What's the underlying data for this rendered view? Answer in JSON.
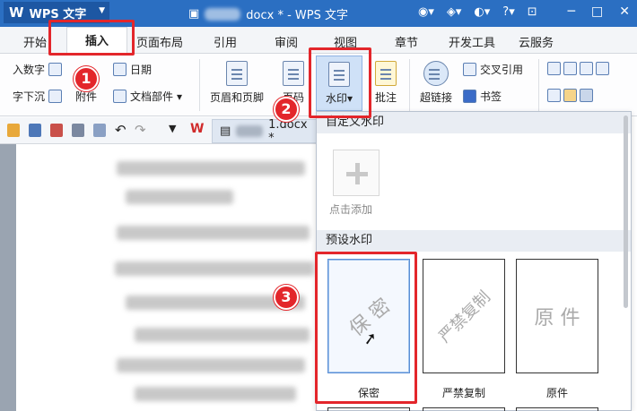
{
  "titlebar": {
    "app_name": "WPS 文字",
    "logo": "W",
    "doc_title_suffix": "docx * - WPS 文字",
    "icons": [
      "skin-icon",
      "star-icon",
      "feedback-icon",
      "help-icon",
      "pin-icon"
    ],
    "help": "?"
  },
  "menu": {
    "tabs": [
      "开始",
      "插入",
      "页面布局",
      "引用",
      "审阅",
      "视图",
      "章节",
      "开发工具",
      "云服务"
    ],
    "active": "插入"
  },
  "ribbon": {
    "insert_number": "入数字",
    "date": "日期",
    "sink": "字下沉",
    "attachment": "附件",
    "doc_parts": "文档部件",
    "header_footer": "页眉和页脚",
    "page_number": "页码",
    "watermark": "水印",
    "comment": "批注",
    "hyperlink": "超链接",
    "cross_reference": "交叉引用",
    "bookmark": "书签"
  },
  "quickbar": {
    "doc_tab_suffix": "1.docx *",
    "wps_logo": "W"
  },
  "watermark_menu": {
    "custom_header": "自定义水印",
    "add_label": "点击添加",
    "preset_header": "预设水印",
    "presets": [
      {
        "label": "保密",
        "text": "保 密"
      },
      {
        "label": "严禁复制",
        "text": "严禁复制"
      },
      {
        "label": "原件",
        "text": "原 件"
      }
    ]
  },
  "annotations": {
    "step1": "1",
    "step2": "2",
    "step3": "3"
  },
  "colors": {
    "titlebar": "#2b6fc2",
    "highlight": "#e3262b",
    "selected": "#cfe1f7"
  }
}
